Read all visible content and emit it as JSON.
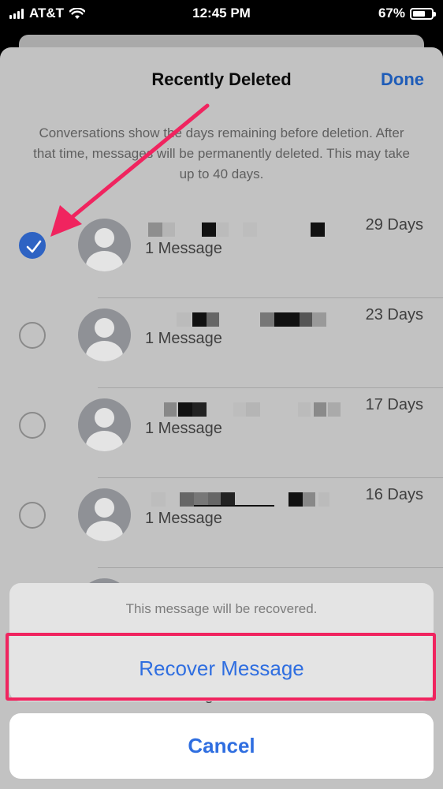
{
  "status_bar": {
    "carrier": "AT&T",
    "time": "12:45 PM",
    "battery_percent": "67%",
    "battery_level": 0.67,
    "wifi_icon": "wifi-icon",
    "signal_icon": "signal-icon"
  },
  "sheet": {
    "title": "Recently Deleted",
    "done_label": "Done",
    "info": "Conversations show the days remaining before deletion. After that time, messages will be permanently deleted. This may take up to 40 days."
  },
  "conversations": [
    {
      "selected": true,
      "message_count": "1 Message",
      "days_remaining": "29 Days"
    },
    {
      "selected": false,
      "message_count": "1 Message",
      "days_remaining": "23 Days"
    },
    {
      "selected": false,
      "message_count": "1 Message",
      "days_remaining": "17 Days"
    },
    {
      "selected": false,
      "message_count": "1 Message",
      "days_remaining": "16 Days"
    },
    {
      "selected": false,
      "message_count": "1 Message",
      "days_remaining": ""
    }
  ],
  "action_sheet": {
    "title": "This message will be recovered.",
    "recover_label": "Recover Message",
    "cancel_label": "Cancel"
  },
  "colors": {
    "accent": "#2f6ee0",
    "highlight": "#f0245f",
    "checkbox_selected": "#2e63c3"
  }
}
